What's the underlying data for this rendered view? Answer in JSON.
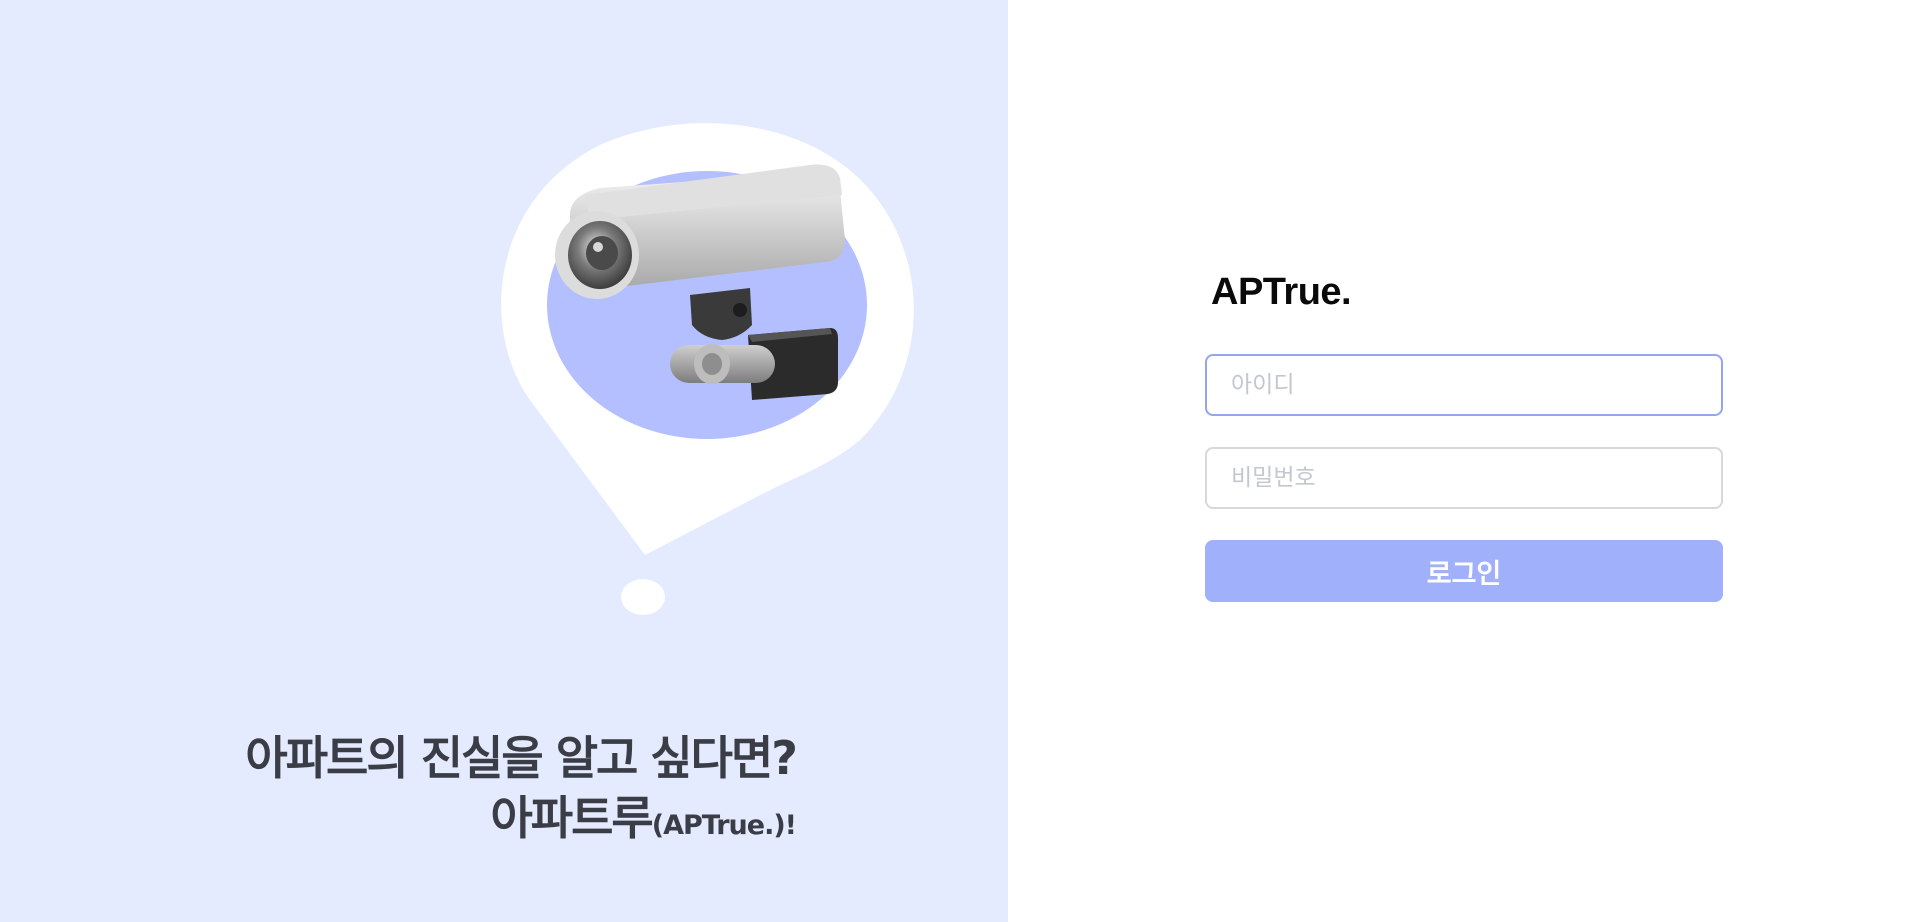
{
  "colors": {
    "left_bg": "#e5ebff",
    "accent": "#a0b0fb",
    "focus_border": "#93a6f0",
    "tagline_text": "#3a3d46"
  },
  "illustration": {
    "icon": "cctv-camera-speech-bubble"
  },
  "tagline": {
    "line1": "아파트의 진실을 알고 싶다면?",
    "line2_main": "아파트루",
    "line2_small": "(APTrue.)",
    "line2_end": "!"
  },
  "login": {
    "logo": "APTrue.",
    "id_placeholder": "아이디",
    "password_placeholder": "비밀번호",
    "button_label": "로그인"
  }
}
